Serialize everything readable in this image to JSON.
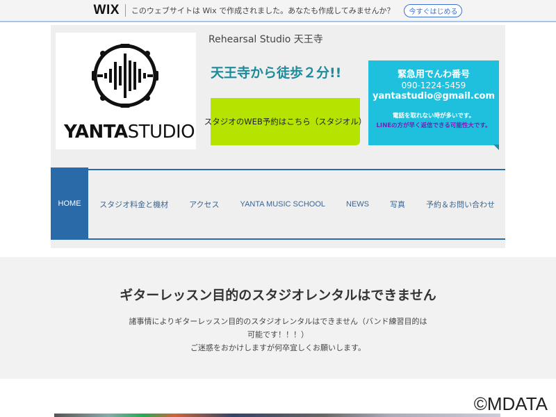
{
  "wix_bar": {
    "logo": "WIX",
    "message": "このウェブサイトは Wix で作成されました。あなたも作成してみませんか？",
    "cta": "今すぐはじめる"
  },
  "header": {
    "logo_bold": "YANTA",
    "logo_light": "STUDIO",
    "studio_name": "Rehearsal Studio 天王寺",
    "catchphrase": "天王寺から徒歩２分!!",
    "web_booking": "スタジオのWEB予約はこちら（スタジオル）",
    "contact": {
      "title": "緊急用でんわ番号",
      "phone": "090-1224-5459",
      "email": "yantastudio@gmail.com",
      "note1": "電話を取れない時が多いです。",
      "note2": "LINEの方が早く返信できる可能性大です。"
    }
  },
  "nav": {
    "items": [
      "HOME",
      "スタジオ料金と機材",
      "アクセス",
      "YANTA MUSIC SCHOOL",
      "NEWS",
      "写真",
      "予約＆お問い合わせ"
    ],
    "active": "HOME",
    "accent_color": "#2a6aa8"
  },
  "notice": {
    "heading": "ギターレッスン目的のスタジオレンタルはできません",
    "line1": "諸事情によりギターレッスン目的のスタジオレンタルはできません（バンド練習目的は",
    "line2": "可能です！！！）",
    "line3": "ご迷惑をおかけしますが何卒宜しくお願いします。"
  },
  "watermark": "©MDATA"
}
